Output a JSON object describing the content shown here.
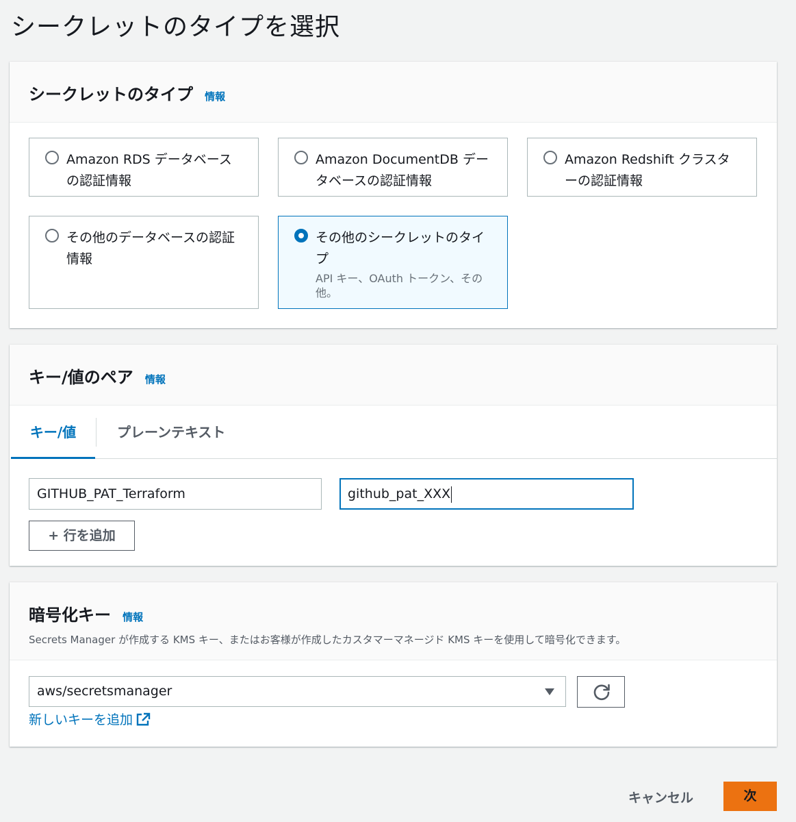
{
  "page": {
    "title": "シークレットのタイプを選択"
  },
  "secret_type": {
    "title": "シークレットのタイプ",
    "info": "情報",
    "options": [
      {
        "label": "Amazon RDS データベースの認証情報",
        "selected": false
      },
      {
        "label": "Amazon DocumentDB データベースの認証情報",
        "selected": false
      },
      {
        "label": "Amazon Redshift クラスターの認証情報",
        "selected": false
      },
      {
        "label": "その他のデータベースの認証情報",
        "selected": false
      },
      {
        "label": "その他のシークレットのタイプ",
        "description": "API キー、OAuth トークン、その他。",
        "selected": true
      }
    ]
  },
  "kv": {
    "title": "キー/値のペア",
    "info": "情報",
    "tabs": [
      {
        "label": "キー/値",
        "active": true
      },
      {
        "label": "プレーンテキスト",
        "active": false
      }
    ],
    "rows": [
      {
        "key": "GITHUB_PAT_Terraform",
        "value": "github_pat_XXX"
      }
    ],
    "add_row": "+ 行を追加"
  },
  "encryption": {
    "title": "暗号化キー",
    "info": "情報",
    "description": "Secrets Manager が作成する KMS キー、またはお客様が作成したカスタマーマネージド KMS キーを使用して暗号化できます。",
    "selected_key": "aws/secretsmanager",
    "new_key_link": "新しいキーを追加"
  },
  "footer": {
    "cancel": "キャンセル",
    "next": "次"
  },
  "colors": {
    "accent": "#0073bb",
    "primary_button": "#ec7211",
    "background": "#f2f3f3"
  }
}
